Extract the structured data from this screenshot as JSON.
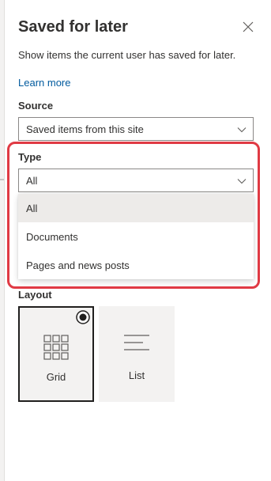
{
  "panel": {
    "title": "Saved for later",
    "description": "Show items the current user has saved for later.",
    "learn_more": "Learn more"
  },
  "source": {
    "label": "Source",
    "selected": "Saved items from this site"
  },
  "type": {
    "label": "Type",
    "selected": "All",
    "options": [
      "All",
      "Documents",
      "Pages and news posts"
    ]
  },
  "layout": {
    "label": "Layout",
    "options": [
      {
        "label": "Grid",
        "icon": "grid-icon",
        "selected": true
      },
      {
        "label": "List",
        "icon": "list-icon",
        "selected": false
      }
    ]
  },
  "colors": {
    "accent": "#005a9e",
    "highlight": "#e03a44",
    "selected_bg": "#edebe9",
    "card_bg": "#f3f2f1"
  }
}
